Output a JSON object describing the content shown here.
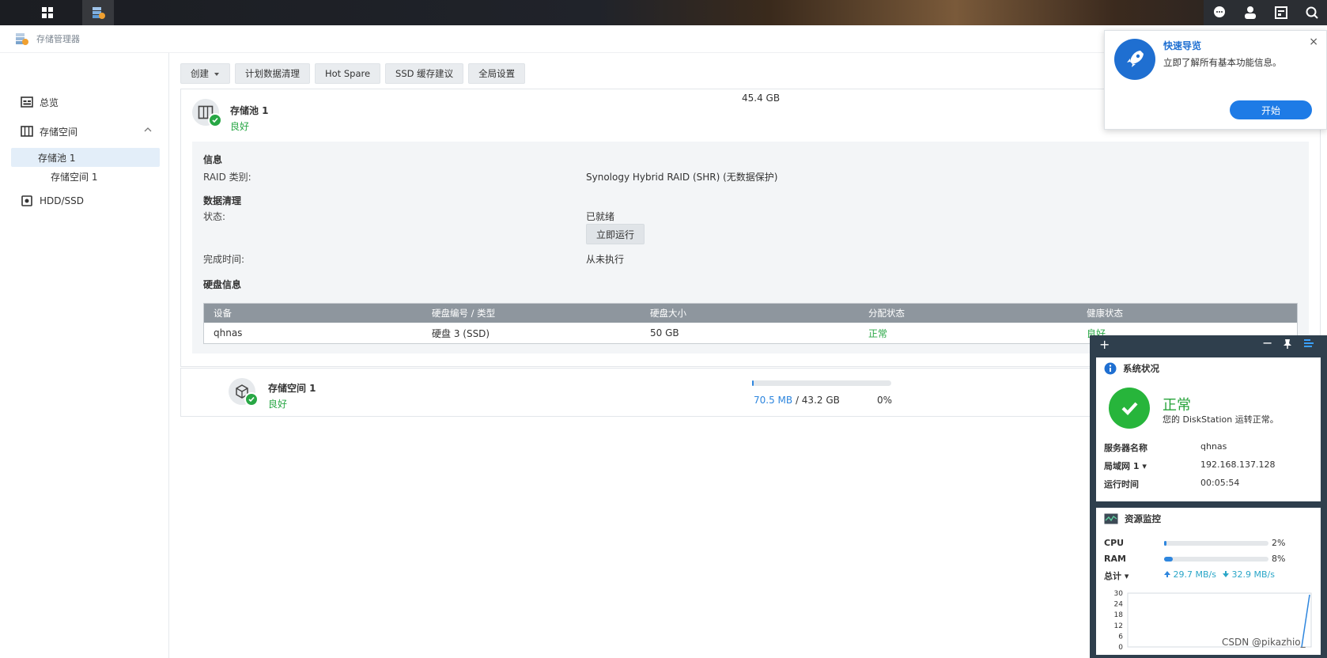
{
  "app": {
    "name": "存储管理器"
  },
  "sidebar": {
    "items": [
      {
        "label": "总览"
      },
      {
        "label": "存储空间"
      },
      {
        "label": "存储池 1"
      },
      {
        "label": "存储空间 1"
      },
      {
        "label": "HDD/SSD"
      }
    ]
  },
  "toolbar": {
    "create": "创建",
    "schedule_scrub": "计划数据清理",
    "hot_spare": "Hot Spare",
    "ssd_cache": "SSD 缓存建议",
    "global_settings": "全局设置"
  },
  "pool": {
    "name": "存储池 1",
    "status": "良好",
    "size": "45.4 GB",
    "info_title": "信息",
    "raid_label": "RAID 类别:",
    "raid_value": "Synology Hybrid RAID (SHR) (无数据保护)",
    "scrub_title": "数据清理",
    "scrub_status_label": "状态:",
    "scrub_status_value": "已就绪",
    "run_now": "立即运行",
    "finish_label": "完成时间:",
    "finish_value": "从未执行",
    "disk_title": "硬盘信息",
    "disk_columns": [
      "设备",
      "硬盘编号 / 类型",
      "硬盘大小",
      "分配状态",
      "健康状态"
    ],
    "disk_rows": [
      {
        "device": "qhnas",
        "type": "硬盘 3 (SSD)",
        "size": "50 GB",
        "alloc": "正常",
        "health": "良好"
      }
    ]
  },
  "volume": {
    "name": "存储空间 1",
    "status": "良好",
    "used": "70.5 MB",
    "total": " / 43.2 GB",
    "percent": "0%",
    "usage_fraction": 0.0016
  },
  "guide": {
    "title": "快速导览",
    "desc": "立即了解所有基本功能信息。",
    "start": "开始",
    "close": "×"
  },
  "widget": {
    "system": {
      "title": "系统状况",
      "state": "正常",
      "desc": "您的 DiskStation 运转正常。",
      "rows": [
        {
          "k": "服务器名称",
          "v": "qhnas"
        },
        {
          "k": "局域网 1 ▾",
          "v": "192.168.137.128"
        },
        {
          "k": "运行时间",
          "v": "00:05:54"
        }
      ]
    },
    "resource": {
      "title": "资源监控",
      "cpu_label": "CPU",
      "cpu_pct": "2%",
      "cpu_value": 2,
      "ram_label": "RAM",
      "ram_pct": "8%",
      "ram_value": 8,
      "total_label": "总计 ▾",
      "upload": "29.7 MB/s",
      "download": "32.9 MB/s",
      "chart_ticks": [
        "30",
        "24",
        "18",
        "12",
        "6",
        "0"
      ]
    }
  },
  "watermark": "CSDN @pikazhio_",
  "colors": {
    "accent": "#1e7be6",
    "ok": "#28a745",
    "header": "#8e969e"
  }
}
